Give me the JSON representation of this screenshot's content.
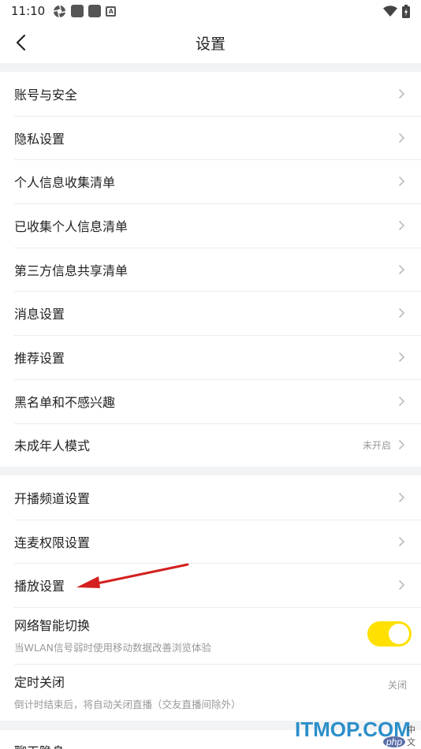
{
  "status_bar": {
    "time": "11:10",
    "icons": [
      "aperture-icon",
      "app-square-icon",
      "app-square-icon",
      "a-icon",
      "wifi-icon",
      "battery-charging-icon"
    ],
    "a_glyph": "A"
  },
  "nav": {
    "back_icon": "chevron-left-icon",
    "title": "设置"
  },
  "section1": [
    {
      "label": "账号与安全"
    },
    {
      "label": "隐私设置"
    },
    {
      "label": "个人信息收集清单"
    },
    {
      "label": "已收集个人信息清单"
    },
    {
      "label": "第三方信息共享清单"
    },
    {
      "label": "消息设置"
    },
    {
      "label": "推荐设置"
    },
    {
      "label": "黑名单和不感兴趣"
    },
    {
      "label": "未成年人模式",
      "value": "未开启"
    }
  ],
  "section2": {
    "rows": [
      {
        "label": "开播频道设置"
      },
      {
        "label": "连麦权限设置"
      },
      {
        "label": "播放设置"
      }
    ],
    "network_switch": {
      "label": "网络智能切换",
      "subtitle": "当WLAN信号弱时使用移动数据改善浏览体验",
      "enabled": true
    },
    "timer_off": {
      "label": "定时关闭",
      "value": "关闭",
      "subtitle": "倒计时结束后，将自动关闭直播（交友直播间除外）"
    }
  },
  "section3": {
    "partial_label": "聊天隐身"
  },
  "colors": {
    "toggle_on": "#ffe000",
    "annotation_arrow": "#d42020",
    "watermark": "#2b8fc9"
  },
  "watermark": {
    "text": "ITMOP.COM",
    "php_logo": "php",
    "php_cn": "中文网"
  }
}
